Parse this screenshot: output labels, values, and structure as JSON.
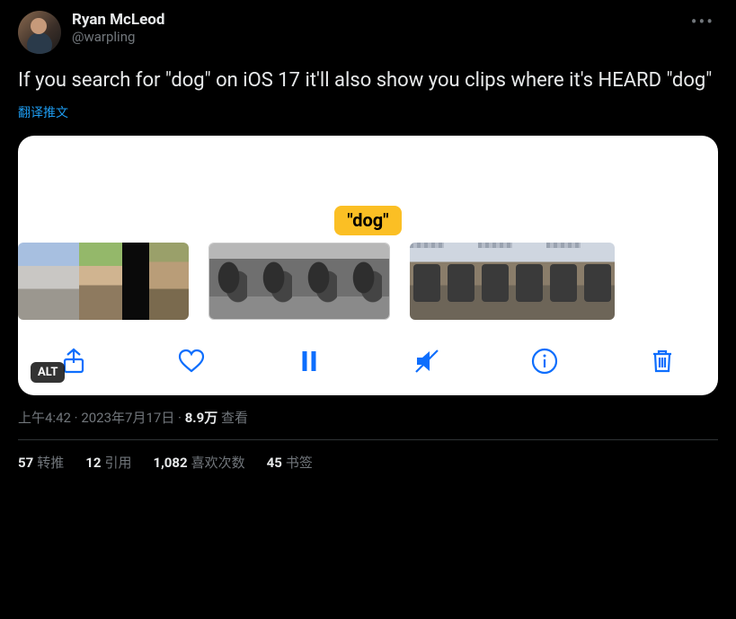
{
  "author": {
    "display_name": "Ryan McLeod",
    "handle": "@warpling"
  },
  "text": "If you search for \"dog\" on iOS 17 it'll also show you clips where it's HEARD \"dog\"",
  "translate_label": "翻译推文",
  "media": {
    "bubble": "\"dog\"",
    "alt_badge": "ALT"
  },
  "meta": {
    "time": "上午4:42",
    "date": "2023年7月17日",
    "views_number": "8.9万",
    "views_label": "查看",
    "separator": " · "
  },
  "stats": {
    "retweets": {
      "count": "57",
      "label": "转推"
    },
    "quotes": {
      "count": "12",
      "label": "引用"
    },
    "likes": {
      "count": "1,082",
      "label": "喜欢次数"
    },
    "bookmarks": {
      "count": "45",
      "label": "书签"
    }
  }
}
